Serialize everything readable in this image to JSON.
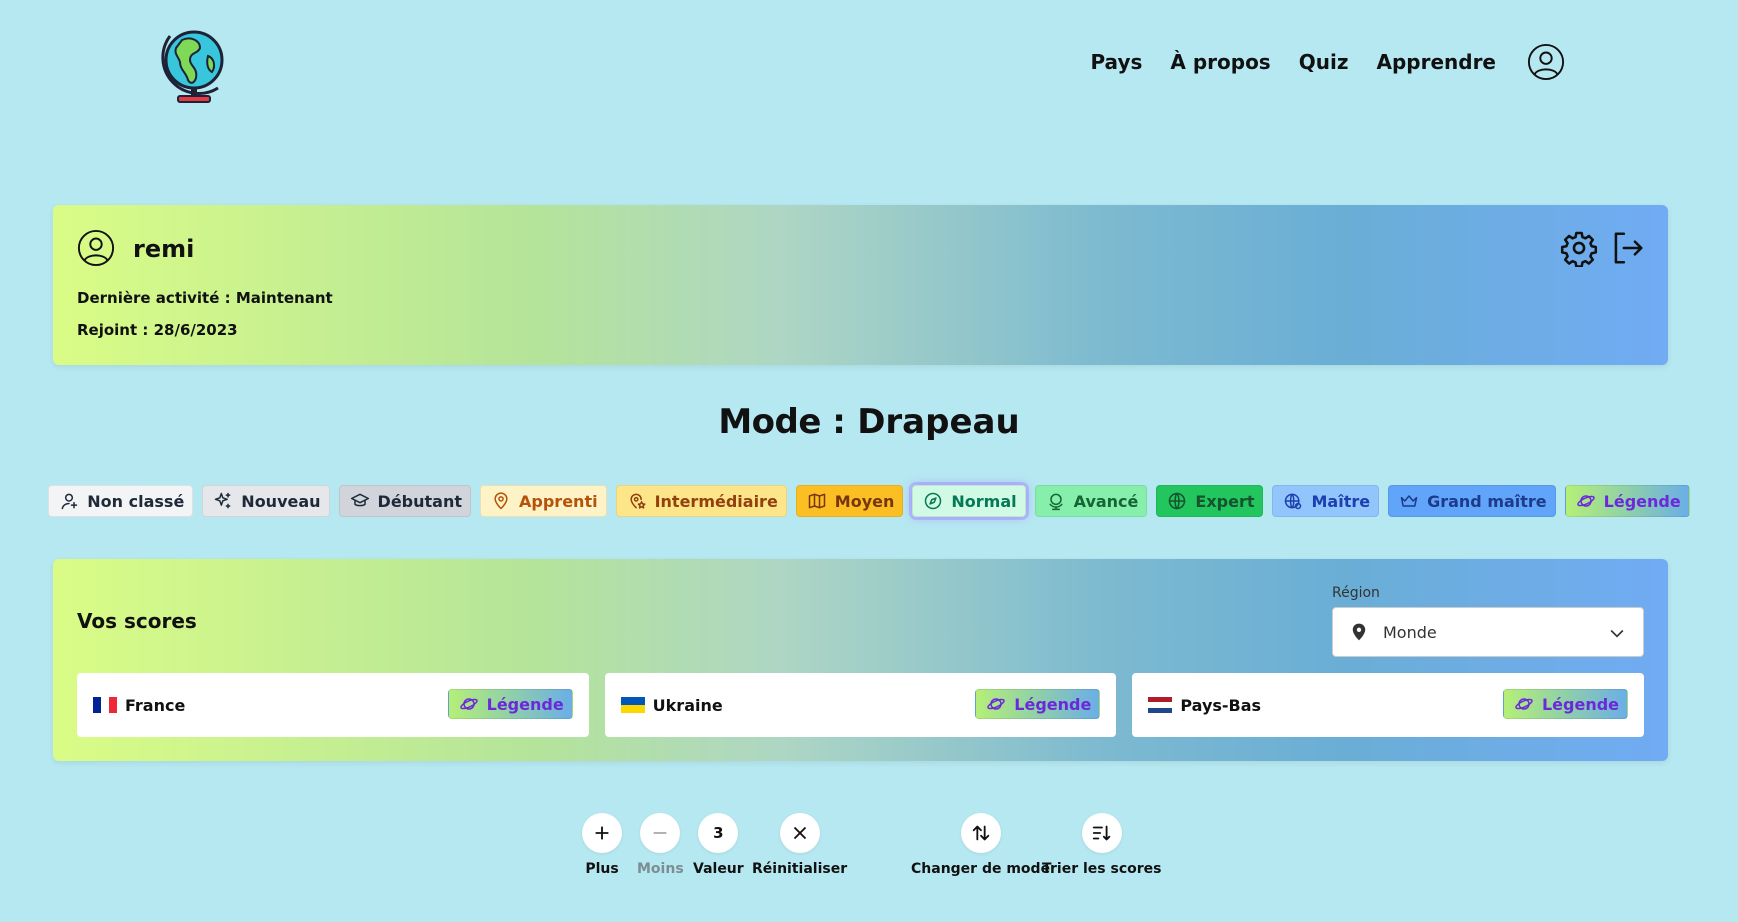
{
  "header": {
    "nav": [
      {
        "label": "Pays"
      },
      {
        "label": "À propos"
      },
      {
        "label": "Quiz"
      },
      {
        "label": "Apprendre"
      }
    ]
  },
  "profile": {
    "username": "remi",
    "last_activity": "Dernière activité : Maintenant",
    "joined": "Rejoint : 28/6/2023"
  },
  "mode": {
    "prefix": "Mode :",
    "value": "Drapeau"
  },
  "levels": [
    {
      "label": "Non classé",
      "icon": "user-icon",
      "bg": "#f3f4f6",
      "fg": "#1f2937"
    },
    {
      "label": "Nouveau",
      "icon": "sparkles-icon",
      "bg": "#e5e7eb",
      "fg": "#1f2937"
    },
    {
      "label": "Débutant",
      "icon": "graduation-cap-icon",
      "bg": "#d1d5db",
      "fg": "#1f2937"
    },
    {
      "label": "Apprenti",
      "icon": "map-pin-icon",
      "bg": "#fef3c7",
      "fg": "#b45309"
    },
    {
      "label": "Intermédiaire",
      "icon": "badge-pin-icon",
      "bg": "#fde68a",
      "fg": "#92400e"
    },
    {
      "label": "Moyen",
      "icon": "map-icon",
      "bg": "#fbbf24",
      "fg": "#78350f"
    },
    {
      "label": "Normal",
      "icon": "compass-icon",
      "bg": "#d1fae5",
      "fg": "#047857",
      "selected": true
    },
    {
      "label": "Avancé",
      "icon": "globe-stand-icon",
      "bg": "#86efac",
      "fg": "#166534"
    },
    {
      "label": "Expert",
      "icon": "globe-icon",
      "bg": "#22c55e",
      "fg": "#14532d"
    },
    {
      "label": "Maître",
      "icon": "globe-grid-icon",
      "bg": "#93c5fd",
      "fg": "#1e40af"
    },
    {
      "label": "Grand maître",
      "icon": "crown-icon",
      "bg": "#60a5fa",
      "fg": "#1e3a8a"
    },
    {
      "label": "Légende",
      "icon": "planet-icon",
      "bg": "gradient",
      "fg": "#6d28d9"
    }
  ],
  "scores": {
    "heading": "Vos scores",
    "region_label": "Région",
    "region_value": "Monde",
    "items": [
      {
        "country": "France",
        "level": "Légende",
        "flag": [
          "#002395",
          "#ffffff",
          "#ed2939"
        ],
        "flag_dir": "v"
      },
      {
        "country": "Ukraine",
        "level": "Légende",
        "flag": [
          "#0057b7",
          "#ffd700"
        ],
        "flag_dir": "h"
      },
      {
        "country": "Pays-Bas",
        "level": "Légende",
        "flag": [
          "#ae1c28",
          "#ffffff",
          "#21468b"
        ],
        "flag_dir": "h"
      }
    ]
  },
  "toolbar": {
    "plus": "Plus",
    "minus": "Moins",
    "value_number": "3",
    "value": "Valeur",
    "reset": "Réinitialiser",
    "change_mode": "Changer de mode",
    "sort": "Trier les scores"
  }
}
